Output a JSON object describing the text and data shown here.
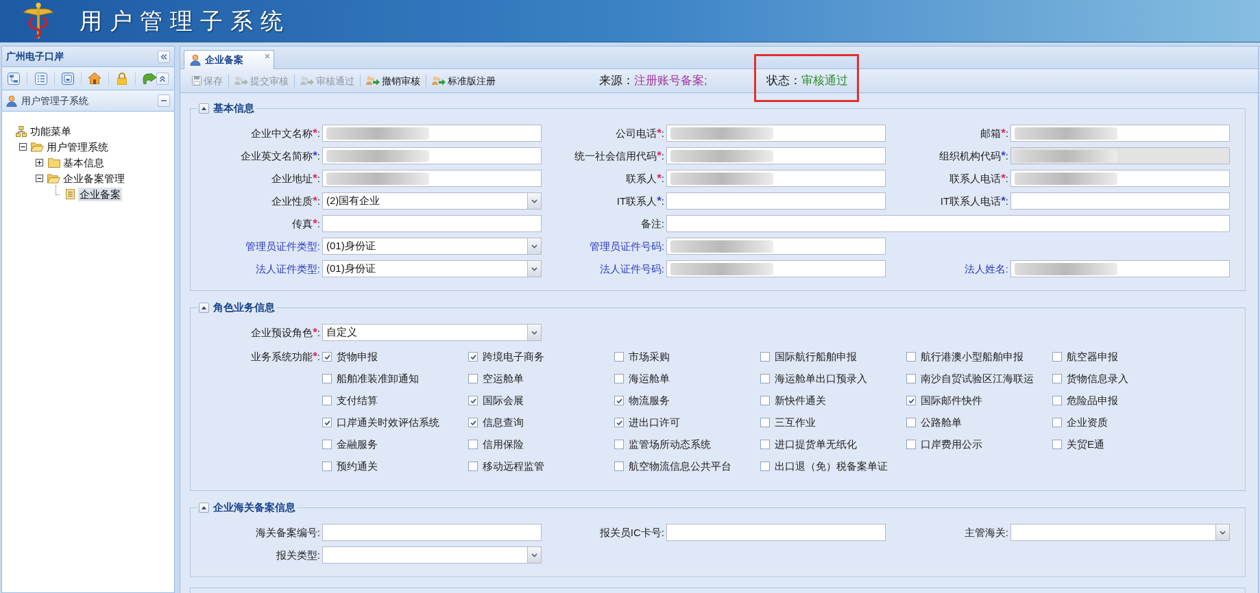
{
  "header": {
    "title": "用户管理子系统"
  },
  "sidebar": {
    "title": "广州电子口岸",
    "section": {
      "title": "用户管理子系统",
      "expanded": true
    },
    "tree": [
      {
        "label": "功能菜单",
        "kind": "root",
        "selected": false,
        "children": [
          {
            "label": "用户管理系统",
            "kind": "folder",
            "expanded": true,
            "selected": false,
            "children": [
              {
                "label": "基本信息",
                "kind": "folder",
                "expanded": false,
                "selected": false
              },
              {
                "label": "企业备案管理",
                "kind": "folder",
                "expanded": true,
                "selected": false,
                "children": [
                  {
                    "label": "企业备案",
                    "kind": "page",
                    "selected": true
                  }
                ]
              }
            ]
          }
        ]
      }
    ]
  },
  "tabs": [
    {
      "label": "企业备案",
      "selected": true,
      "closable": true
    }
  ],
  "toolbar": {
    "buttons": [
      {
        "label": "保存",
        "kind": "save",
        "disabled": true
      },
      {
        "label": "提交审核",
        "kind": "workflow",
        "disabled": true
      },
      {
        "label": "审核通过",
        "kind": "workflow",
        "disabled": true
      },
      {
        "label": "撤销审核",
        "kind": "workflow",
        "disabled": false
      },
      {
        "label": "标准版注册",
        "kind": "workflow",
        "disabled": false
      }
    ],
    "source": {
      "label": "来源：",
      "value": "注册账号备案;"
    },
    "status": {
      "label": "状态：",
      "value": "审核通过",
      "highlighted": true
    }
  },
  "sections": [
    {
      "title": "基本信息",
      "expanded": true,
      "rows": [
        [
          {
            "label": "企业中文名称",
            "mark": {
              "text": "*",
              "color": "#e0245e"
            },
            "colon": ":",
            "color": "#222222",
            "kind": "text",
            "redacted": true,
            "disabled": false
          },
          {
            "label": "公司电话",
            "mark": {
              "text": "*",
              "color": "#e0245e"
            },
            "colon": ":",
            "color": "#222222",
            "kind": "text",
            "redacted": true,
            "disabled": false
          },
          {
            "label": "邮箱",
            "mark": {
              "text": "*",
              "color": "#e0245e"
            },
            "colon": ":",
            "color": "#222222",
            "kind": "text",
            "redacted": true,
            "disabled": false
          }
        ],
        [
          {
            "label": "企业英文名简称",
            "mark": {
              "text": "*",
              "color": "#3a3fc8"
            },
            "colon": ":",
            "color": "#222222",
            "kind": "text",
            "redacted": true,
            "disabled": false
          },
          {
            "label": "统一社会信用代码",
            "mark": {
              "text": "*",
              "color": "#e0245e"
            },
            "colon": ":",
            "color": "#222222",
            "kind": "text",
            "redacted": true,
            "disabled": false
          },
          {
            "label": "组织机构代码",
            "mark": {
              "text": "*",
              "color": "#3a3fc8"
            },
            "colon": ":",
            "color": "#222222",
            "kind": "text",
            "redacted": true,
            "disabled": true
          }
        ],
        [
          {
            "label": "企业地址",
            "mark": {
              "text": "*",
              "color": "#e0245e"
            },
            "colon": ":",
            "color": "#222222",
            "kind": "text",
            "redacted": true,
            "disabled": false
          },
          {
            "label": "联系人",
            "mark": {
              "text": "*",
              "color": "#e0245e"
            },
            "colon": ":",
            "color": "#222222",
            "kind": "text",
            "redacted": true,
            "disabled": false
          },
          {
            "label": "联系人电话",
            "mark": {
              "text": "*",
              "color": "#e0245e"
            },
            "colon": ":",
            "color": "#222222",
            "kind": "text",
            "redacted": true,
            "disabled": false
          }
        ],
        [
          {
            "label": "企业性质",
            "mark": {
              "text": "*",
              "color": "#e0245e"
            },
            "colon": ":",
            "color": "#222222",
            "kind": "select",
            "value": "(2)国有企业",
            "redacted": false,
            "disabled": false
          },
          {
            "label": "IT联系人",
            "mark": {
              "text": "*",
              "color": "#3a3fc8"
            },
            "colon": ":",
            "color": "#222222",
            "kind": "text",
            "redacted": false,
            "disabled": false
          },
          {
            "label": "IT联系人电话",
            "mark": {
              "text": "*",
              "color": "#3a3fc8"
            },
            "colon": ":",
            "color": "#222222",
            "kind": "text",
            "redacted": false,
            "disabled": false
          }
        ],
        [
          {
            "label": "传真",
            "mark": {
              "text": "*",
              "color": "#e0245e"
            },
            "colon": ":",
            "color": "#222222",
            "kind": "text",
            "redacted": false,
            "disabled": false
          },
          {
            "label": "备注",
            "colon": ":",
            "color": "#222222",
            "kind": "wide_text",
            "redacted": false,
            "disabled": false
          }
        ],
        [
          {
            "label": "管理员证件类型",
            "colon": ":",
            "color": "#2b3bc4",
            "kind": "select",
            "value": "(01)身份证",
            "redacted": false,
            "disabled": false
          },
          {
            "label": "管理员证件号码",
            "colon": ":",
            "color": "#2b3bc4",
            "kind": "text",
            "redacted": true,
            "disabled": false
          }
        ],
        [
          {
            "label": "法人证件类型",
            "colon": ":",
            "color": "#2b3bc4",
            "kind": "select",
            "value": "(01)身份证",
            "redacted": false,
            "disabled": false
          },
          {
            "label": "法人证件号码",
            "colon": ":",
            "color": "#2b3bc4",
            "kind": "text",
            "redacted": true,
            "disabled": false
          },
          {
            "label": "法人姓名",
            "colon": ":",
            "color": "#2b3bc4",
            "kind": "text",
            "redacted": true,
            "disabled": false
          }
        ]
      ]
    },
    {
      "title": "角色业务信息",
      "expanded": true,
      "rows": [
        [
          {
            "label": "企业预设角色",
            "mark": {
              "text": "*",
              "color": "#e0245e"
            },
            "colon": ":",
            "color": "#222222",
            "kind": "select",
            "value": "自定义",
            "redacted": false,
            "disabled": false
          }
        ]
      ],
      "options": {
        "label": "业务系统功能",
        "mark": {
          "text": "*",
          "color": "#e0245e"
        },
        "colon": ":",
        "color": "#222222",
        "items": [
          {
            "label": "货物申报",
            "checked": true
          },
          {
            "label": "跨境电子商务",
            "checked": true
          },
          {
            "label": "市场采购",
            "checked": false
          },
          {
            "label": "国际航行船舶申报",
            "checked": false
          },
          {
            "label": "航行港澳小型船舶申报",
            "checked": false
          },
          {
            "label": "航空器申报",
            "checked": false
          },
          {
            "label": "船舶准装准卸通知",
            "checked": false
          },
          {
            "label": "空运舱单",
            "checked": false
          },
          {
            "label": "海运舱单",
            "checked": false
          },
          {
            "label": "海运舱单出口预录入",
            "checked": false
          },
          {
            "label": "南沙自贸试验区江海联运",
            "checked": false
          },
          {
            "label": "货物信息录入",
            "checked": false
          },
          {
            "label": "支付结算",
            "checked": false
          },
          {
            "label": "国际会展",
            "checked": true
          },
          {
            "label": "物流服务",
            "checked": true
          },
          {
            "label": "新快件通关",
            "checked": false
          },
          {
            "label": "国际邮件快件",
            "checked": true
          },
          {
            "label": "危险品申报",
            "checked": false
          },
          {
            "label": "口岸通关时效评估系统",
            "checked": true
          },
          {
            "label": "信息查询",
            "checked": true
          },
          {
            "label": "进出口许可",
            "checked": true
          },
          {
            "label": "三互作业",
            "checked": false
          },
          {
            "label": "公路舱单",
            "checked": false
          },
          {
            "label": "企业资质",
            "checked": false
          },
          {
            "label": "金融服务",
            "checked": false
          },
          {
            "label": "信用保险",
            "checked": false
          },
          {
            "label": "监管场所动态系统",
            "checked": false
          },
          {
            "label": "进口提货单无纸化",
            "checked": false
          },
          {
            "label": "口岸费用公示",
            "checked": false
          },
          {
            "label": "关贸E通",
            "checked": false
          },
          {
            "label": "预约通关",
            "checked": false
          },
          {
            "label": "移动远程监管",
            "checked": false
          },
          {
            "label": "航空物流信息公共平台",
            "checked": false
          },
          {
            "label": "出口退（免）税备案单证",
            "checked": false
          }
        ]
      }
    },
    {
      "title": "企业海关备案信息",
      "expanded": true,
      "rows": [
        [
          {
            "label": "海关备案编号",
            "colon": ":",
            "color": "#222222",
            "kind": "text",
            "redacted": false,
            "disabled": false
          },
          {
            "label": "报关员IC卡号",
            "colon": ":",
            "color": "#222222",
            "kind": "text",
            "redacted": false,
            "disabled": false
          },
          {
            "label": "主管海关",
            "colon": ":",
            "color": "#222222",
            "kind": "select",
            "redacted": false,
            "disabled": false
          }
        ],
        [
          {
            "label": "报关类型",
            "colon": ":",
            "color": "#222222",
            "kind": "select",
            "redacted": false,
            "disabled": false
          }
        ]
      ]
    }
  ]
}
